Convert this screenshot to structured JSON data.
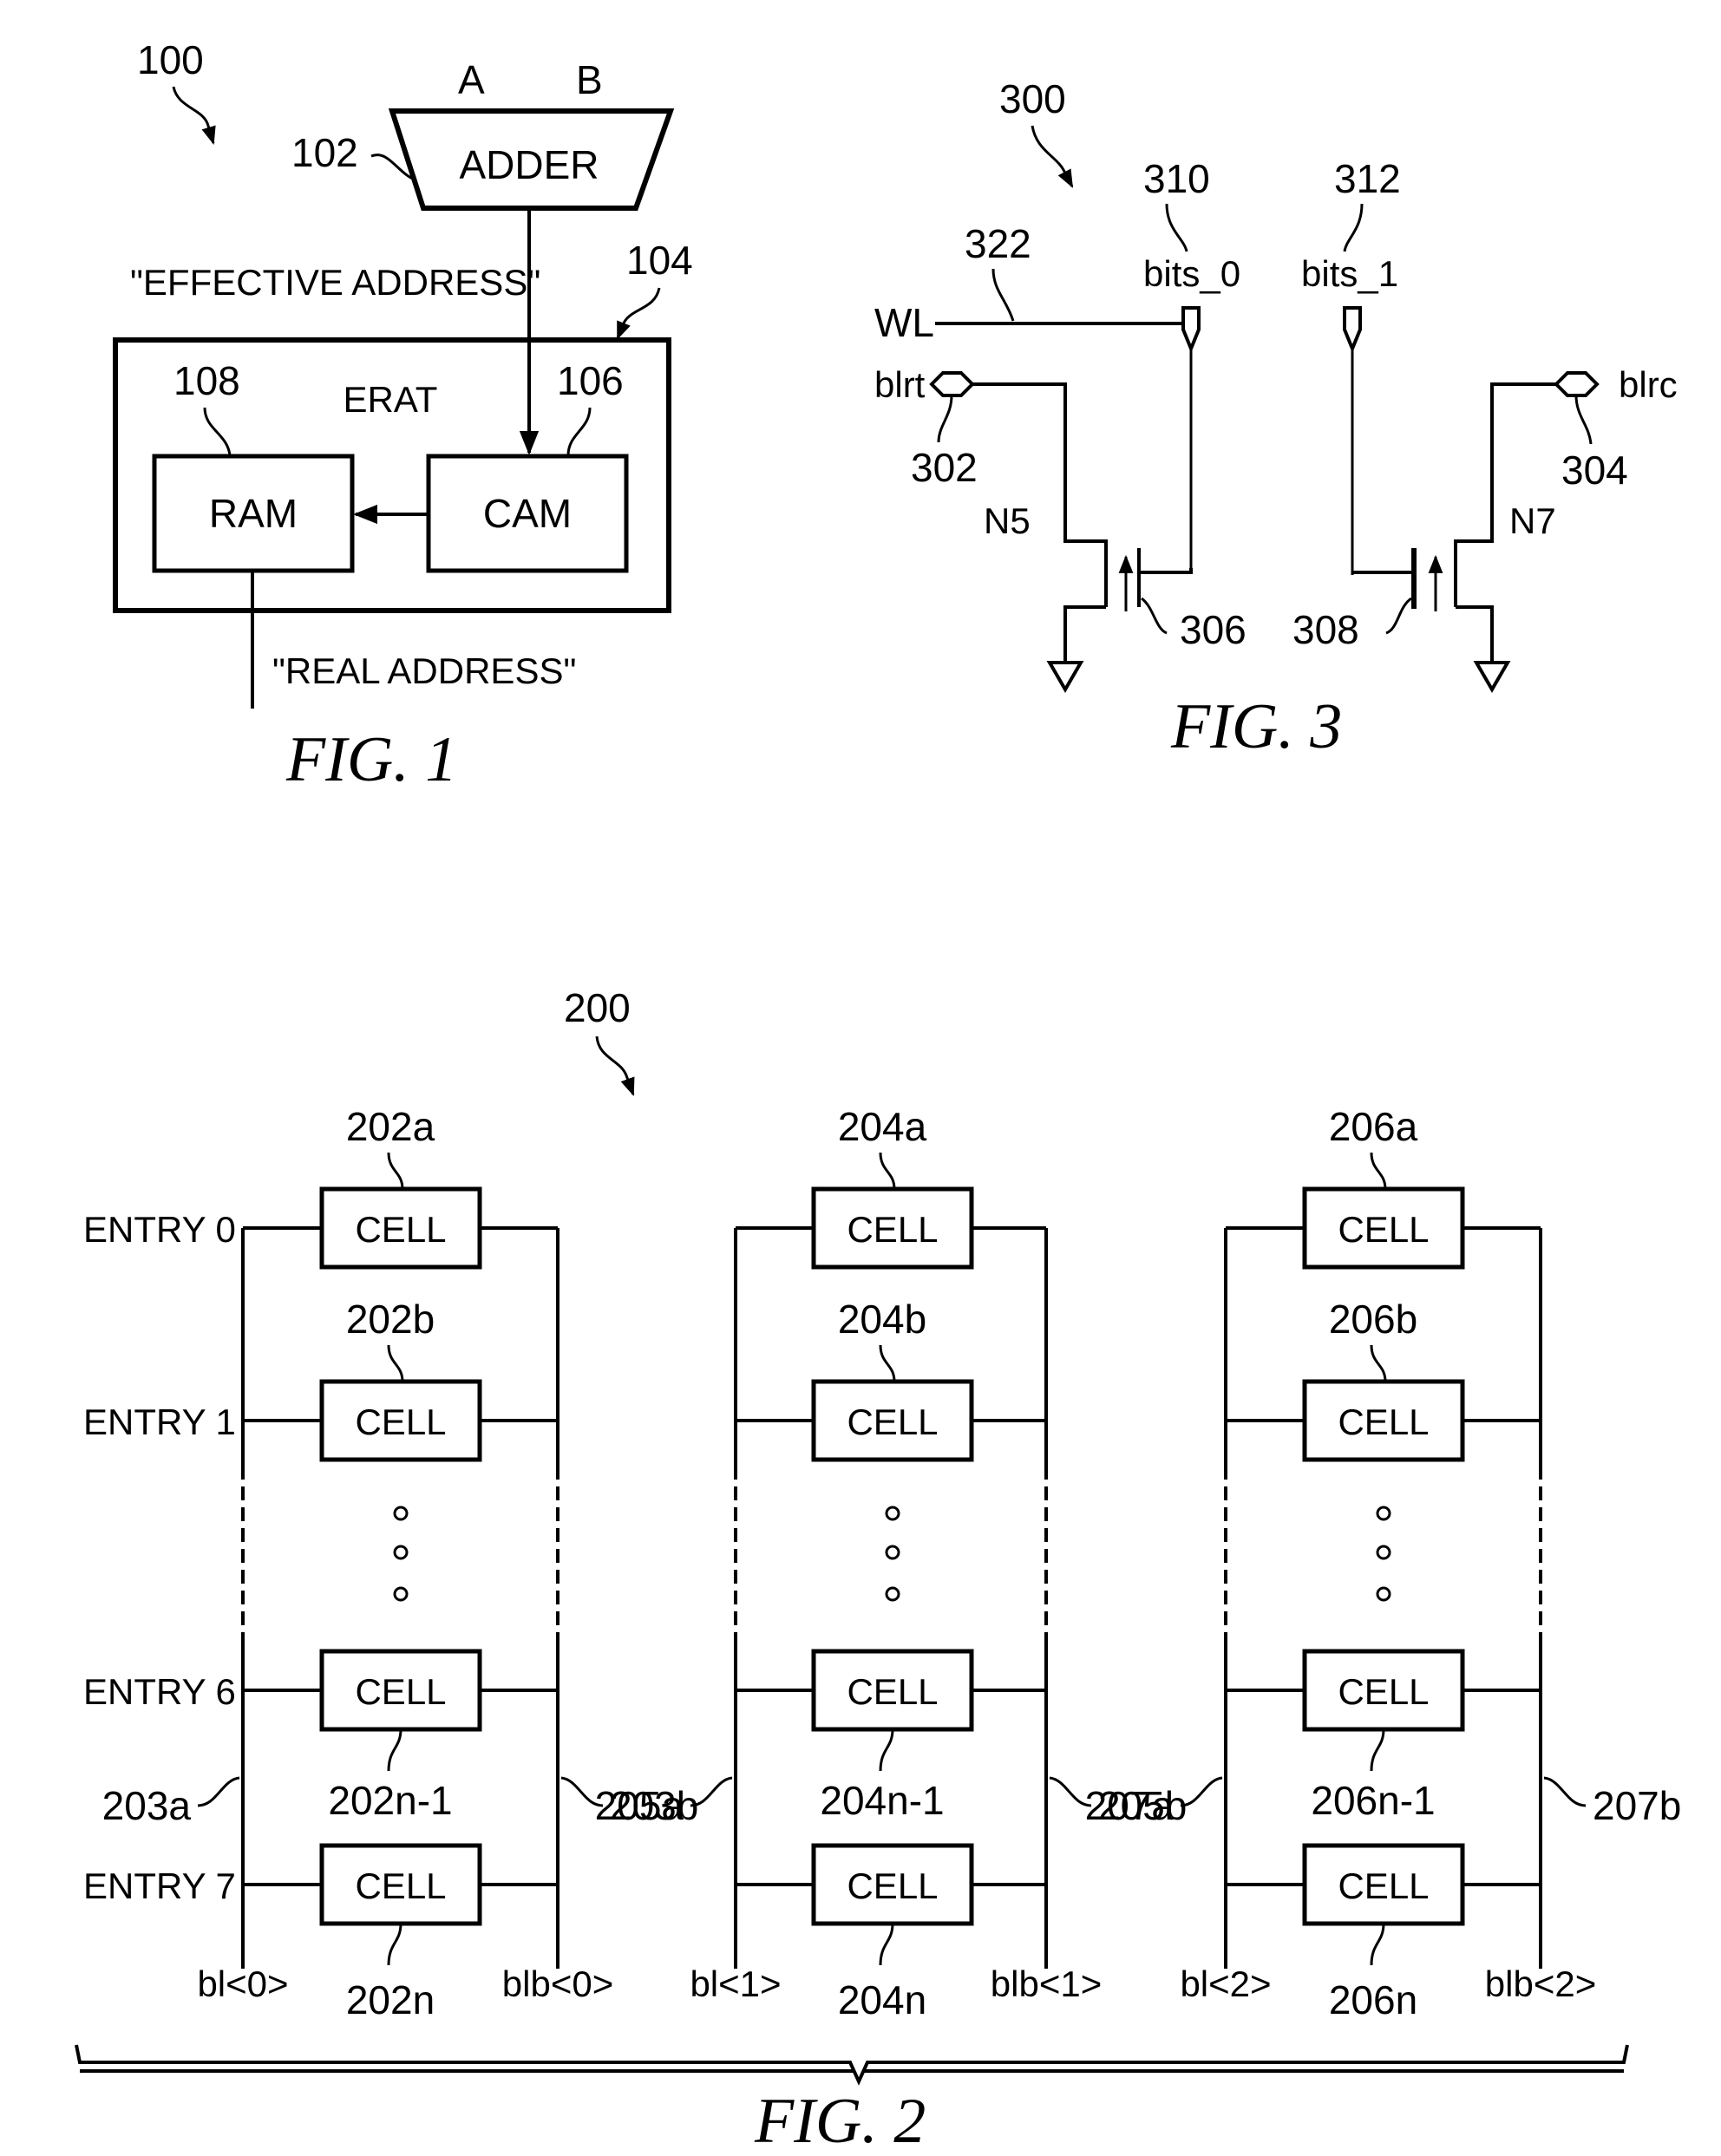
{
  "fig1": {
    "ref": "100",
    "caption": "FIG. 1",
    "adder": {
      "ref": "102",
      "label": "ADDER",
      "input_a": "A",
      "input_b": "B"
    },
    "effective_address": "\"EFFECTIVE ADDRESS\"",
    "erat": {
      "ref": "104",
      "label": "ERAT"
    },
    "ram": {
      "ref": "108",
      "label": "RAM"
    },
    "cam": {
      "ref": "106",
      "label": "CAM"
    },
    "real_address": "\"REAL ADDRESS\""
  },
  "fig3": {
    "ref": "300",
    "caption": "FIG. 3",
    "wl": {
      "label": "WL",
      "ref": "322"
    },
    "bits0": {
      "label": "bits_0",
      "ref": "310"
    },
    "bits1": {
      "label": "bits_1",
      "ref": "312"
    },
    "blrt": {
      "label": "blrt",
      "ref": "302"
    },
    "blrc": {
      "label": "blrc",
      "ref": "304"
    },
    "n5": {
      "label": "N5",
      "ref": "306"
    },
    "n7": {
      "label": "N7",
      "ref": "308"
    }
  },
  "fig2": {
    "ref": "200",
    "caption": "FIG. 2",
    "cell_label": "CELL",
    "entries": [
      "ENTRY 0",
      "ENTRY 1",
      "ENTRY 6",
      "ENTRY 7"
    ],
    "columns": [
      {
        "cell_refs": [
          "202a",
          "202b",
          "202n-1",
          "202n"
        ],
        "bl": "bl<0>",
        "blb": "blb<0>",
        "bl_ref": "203a",
        "blb_ref": "203b"
      },
      {
        "cell_refs": [
          "204a",
          "204b",
          "204n-1",
          "204n"
        ],
        "bl": "bl<1>",
        "blb": "blb<1>",
        "bl_ref": "205a",
        "blb_ref": "205b"
      },
      {
        "cell_refs": [
          "206a",
          "206b",
          "206n-1",
          "206n"
        ],
        "bl": "bl<2>",
        "blb": "blb<2>",
        "bl_ref": "207a",
        "blb_ref": "207b"
      }
    ]
  }
}
